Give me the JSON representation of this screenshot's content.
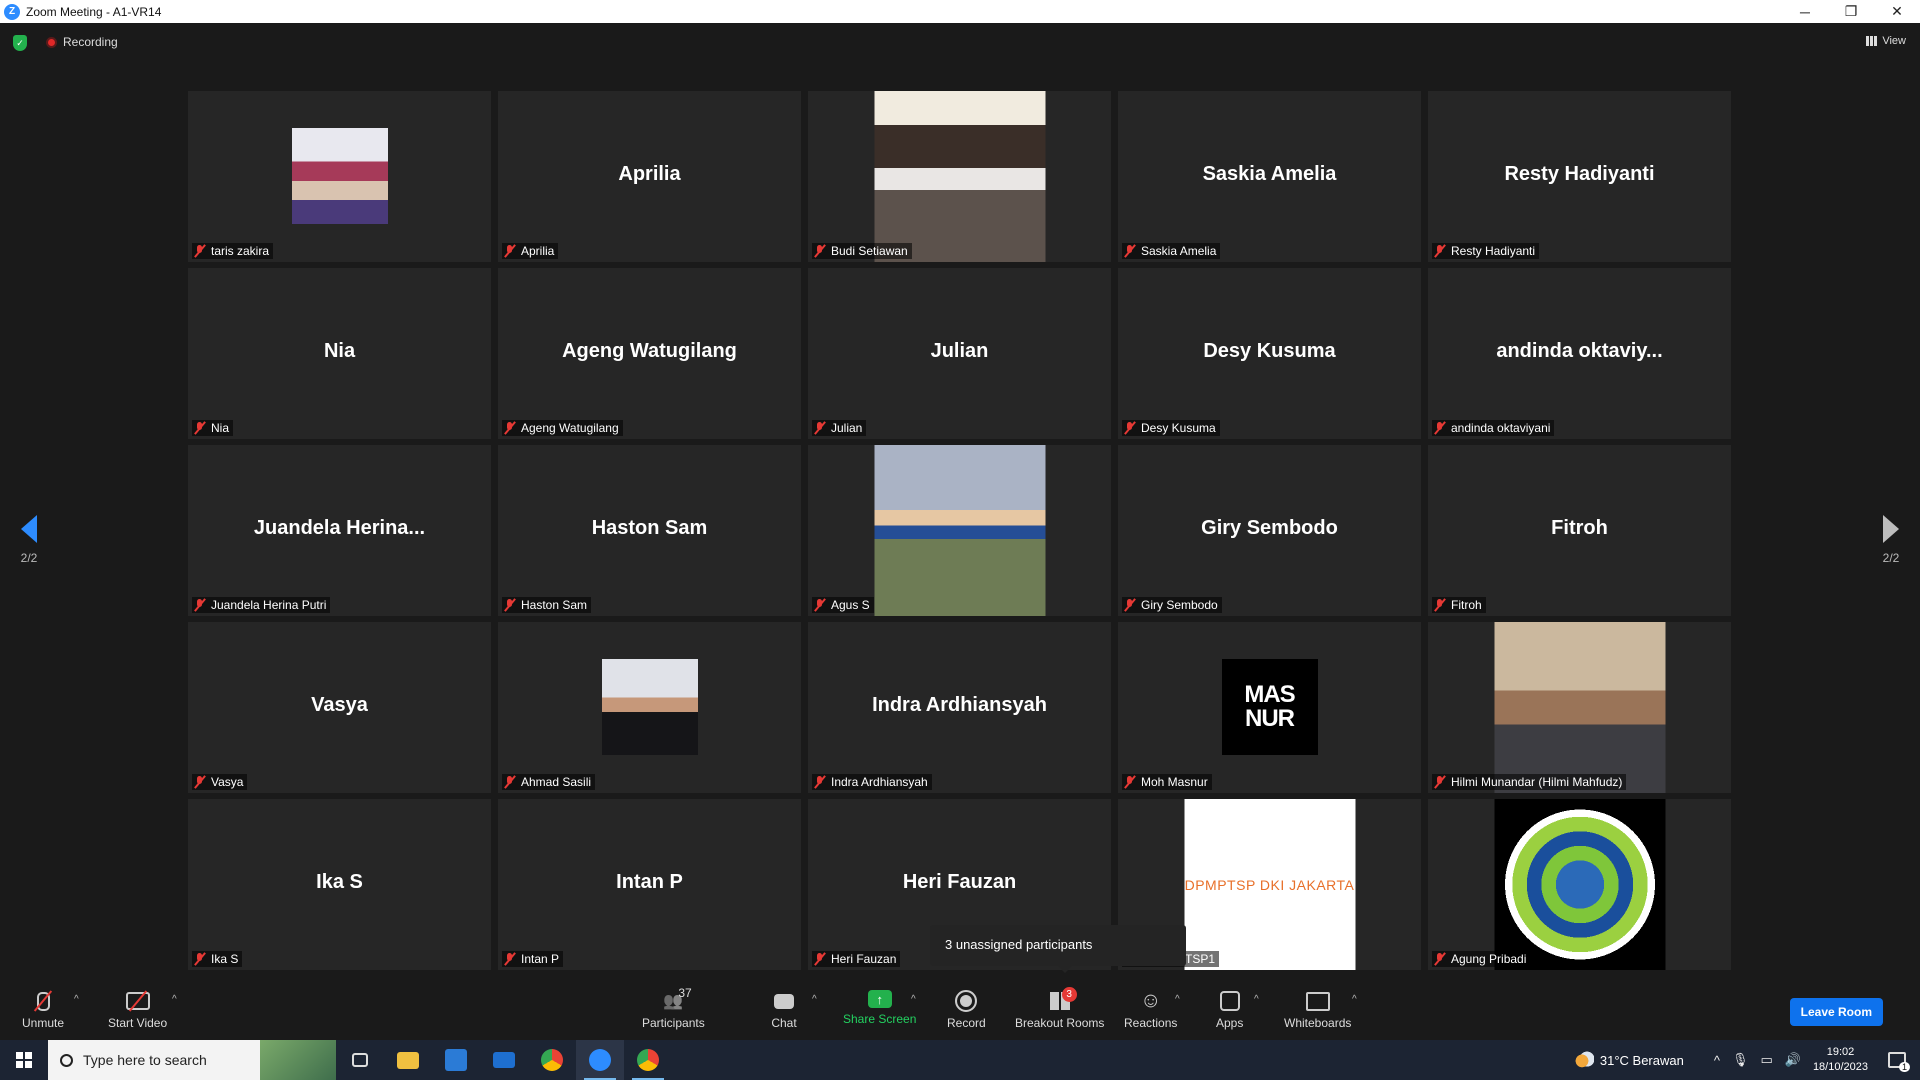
{
  "window": {
    "title": "Zoom Meeting - A1-VR14",
    "minimize": "─",
    "restore": "❐",
    "close": "✕"
  },
  "topbar": {
    "recording_label": "Recording",
    "view_label": "View"
  },
  "pagination": {
    "left": "2/2",
    "right": "2/2"
  },
  "tiles": [
    {
      "display": "",
      "label": "taris zakira",
      "photo": "group"
    },
    {
      "display": "Aprilia",
      "label": "Aprilia"
    },
    {
      "display": "",
      "label": "Budi Setiawan",
      "photo": "budi"
    },
    {
      "display": "Saskia Amelia",
      "label": "Saskia Amelia"
    },
    {
      "display": "Resty Hadiyanti",
      "label": "Resty Hadiyanti"
    },
    {
      "display": "Nia",
      "label": "Nia"
    },
    {
      "display": "Ageng Watugilang",
      "label": "Ageng Watugilang"
    },
    {
      "display": "Julian",
      "label": "Julian"
    },
    {
      "display": "Desy Kusuma",
      "label": "Desy Kusuma"
    },
    {
      "display": "andinda  oktaviy...",
      "label": "andinda oktaviyani"
    },
    {
      "display": "Juandela  Herina...",
      "label": "Juandela Herina Putri"
    },
    {
      "display": "Haston Sam",
      "label": "Haston Sam"
    },
    {
      "display": "",
      "label": "Agus S",
      "photo": "agus"
    },
    {
      "display": "Giry Sembodo",
      "label": "Giry Sembodo"
    },
    {
      "display": "Fitroh",
      "label": "Fitroh"
    },
    {
      "display": "Vasya",
      "label": "Vasya"
    },
    {
      "display": "",
      "label": "Ahmad Sasili",
      "photo": "ahmad"
    },
    {
      "display": "Indra Ardhiansyah",
      "label": "Indra Ardhiansyah"
    },
    {
      "display": "",
      "label": "Moh Masnur",
      "photo": "masnur",
      "logo_line1": "MAS",
      "logo_line2": "NUR"
    },
    {
      "display": "",
      "label": "Hilmi Munandar (Hilmi Mahfudz)",
      "photo": "hilmi"
    },
    {
      "display": "Ika S",
      "label": "Ika S"
    },
    {
      "display": "Intan P",
      "label": "Intan P"
    },
    {
      "display": "Heri Fauzan",
      "label": "Heri Fauzan"
    },
    {
      "display": "",
      "label": "s DPMPTSP1",
      "photo": "dpm",
      "logo_text": "DPMPTSP DKI JAKARTA"
    },
    {
      "display": "",
      "label": "Agung Pribadi",
      "photo": "globe"
    }
  ],
  "tooltip": {
    "text": "3 unassigned participants"
  },
  "toolbar": {
    "unmute": "Unmute",
    "start_video": "Start Video",
    "participants": "Participants",
    "participants_count": "37",
    "chat": "Chat",
    "share_screen": "Share Screen",
    "record": "Record",
    "breakout_rooms": "Breakout Rooms",
    "breakout_badge": "3",
    "reactions": "Reactions",
    "apps": "Apps",
    "whiteboards": "Whiteboards",
    "leave": "Leave Room",
    "caret": "^"
  },
  "taskbar": {
    "search_placeholder": "Type here to search",
    "weather": "31°C  Berawan",
    "time": "19:02",
    "date": "18/10/2023",
    "notif_count": "1",
    "tray_chevron": "^"
  },
  "colors": {
    "zoom_blue": "#2d8cff",
    "share_green": "#23b14d",
    "muted_red": "#e53935",
    "leave_blue": "#0e72ed"
  }
}
